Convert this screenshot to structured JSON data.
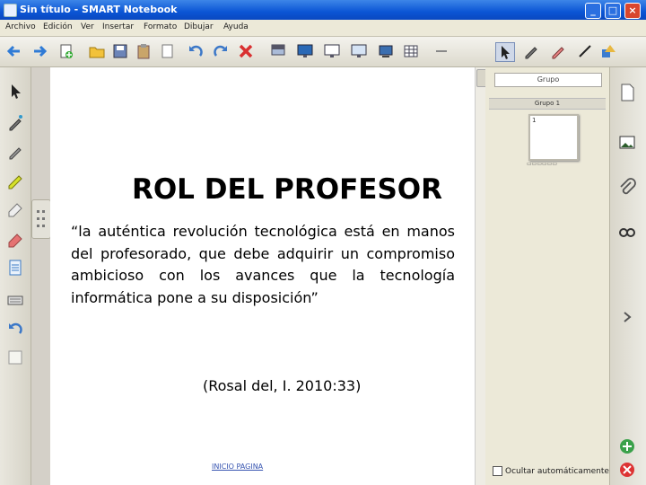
{
  "window": {
    "title": "Sin título - SMART Notebook"
  },
  "menu": [
    "Archivo",
    "Edición",
    "Ver",
    "Insertar",
    "Formato",
    "Dibujar",
    "Ayuda"
  ],
  "slide": {
    "title": "ROL DEL PROFESOR",
    "quote": "“la auténtica revolución tecnológica está en manos del profesorado, que debe adquirir un compromiso ambicioso con los avances que la tecnología informática pone a su disposición”",
    "citation": "(Rosal del, I. 2010:33)",
    "bottom_link": "INICIO PAGINA"
  },
  "page_sorter": {
    "dropdown_value": "Grupo",
    "group_label": "Grupo 1",
    "page_number": "1",
    "auto_hide_label": "Ocultar automáticamente"
  },
  "colors": {
    "titlebar": "#0b55d5",
    "canvas": "#ffffff",
    "chrome": "#ece9d8"
  },
  "icons": {
    "toolbar": [
      "back-icon",
      "forward-icon",
      "add-page-icon",
      "open-icon",
      "save-icon",
      "paste-icon",
      "undo-icon",
      "redo-icon",
      "delete-icon",
      "screen-shade-icon",
      "full-screen-icon",
      "display-icon",
      "capture-icon",
      "table-icon",
      "select-icon",
      "pen-icon",
      "eraser-icon",
      "line-icon",
      "shapes-icon"
    ],
    "left": [
      "select-icon",
      "magic-pen-icon",
      "creative-pen-icon",
      "highlighter-icon",
      "eraser-icon",
      "eraser-red-icon",
      "page-icon",
      "keyboard-icon",
      "undo-icon",
      "blank-icon"
    ],
    "right": [
      "page-sorter-icon",
      "gallery-icon",
      "attachments-icon",
      "properties-icon",
      "collapse-arrow-icon",
      "add-page-icon",
      "delete-page-icon"
    ]
  }
}
